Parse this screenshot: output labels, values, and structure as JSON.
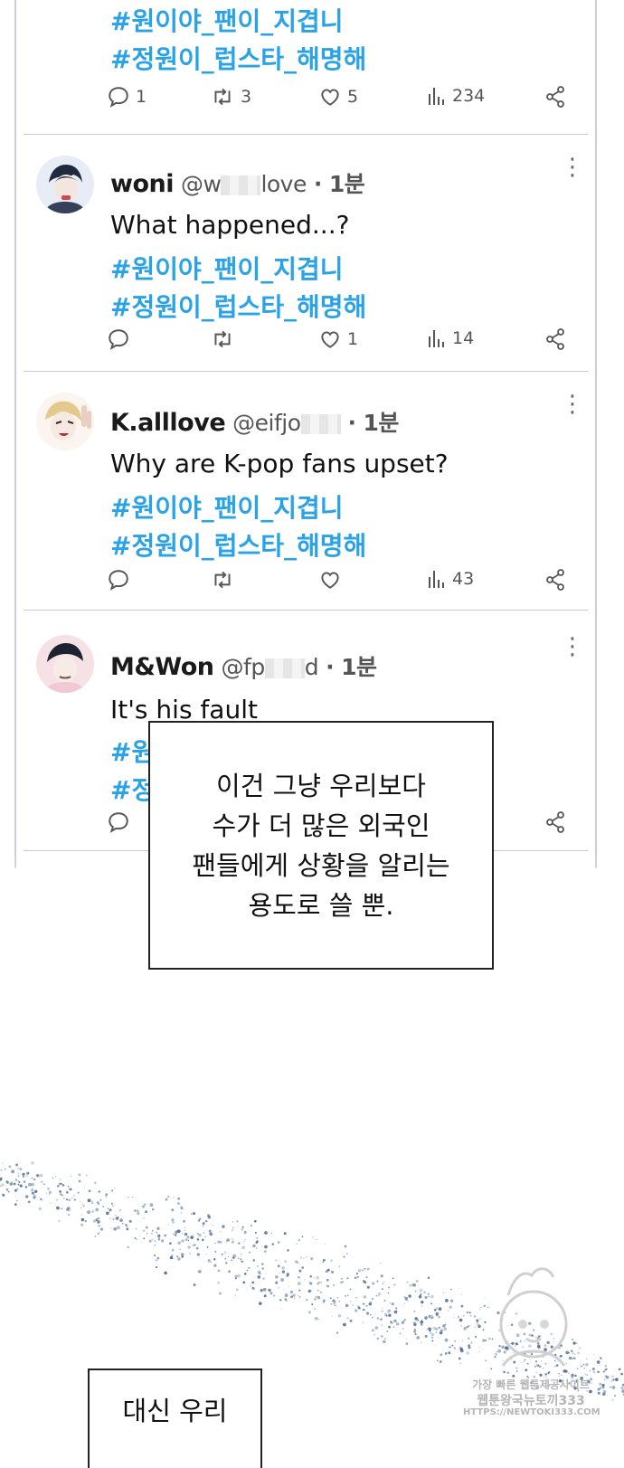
{
  "tweets": [
    {
      "tags": [
        "#원이야_팬이_지겹니",
        "#정원이_럽스타_해명해"
      ],
      "replies": "1",
      "retweets": "3",
      "likes": "5",
      "views": "234"
    },
    {
      "name": "woni",
      "handle_start": "@w",
      "handle_end": "love",
      "time": "1분",
      "text": "What happened...?",
      "tags": [
        "#원이야_팬이_지겹니",
        "#정원이_럽스타_해명해"
      ],
      "replies": "",
      "retweets": "",
      "likes": "1",
      "views": "14"
    },
    {
      "name": "K.alllove",
      "handle_start": "@eifjo",
      "handle_end": "",
      "time": "1분",
      "text": "Why are K-pop fans upset?",
      "tags": [
        "#원이야_팬이_지겹니",
        "#정원이_럽스타_해명해"
      ],
      "replies": "",
      "retweets": "",
      "likes": "",
      "views": "43"
    },
    {
      "name": "M&Won",
      "handle_start": "@fp",
      "handle_end": "d",
      "time": "1분",
      "text": "It's his fault",
      "tags": [
        "#원",
        "#정"
      ]
    }
  ],
  "separator": "·",
  "more_glyph": "⋮",
  "caption": {
    "lines": [
      "이건 그냥 우리보다",
      "수가 더 많은 외국인",
      "팬들에게 상황을 알리는",
      "용도로 쓸 뿐."
    ]
  },
  "caption2": {
    "text": "대신 우리"
  },
  "watermark": {
    "line1": "가장 빠른 웹툰제공사이트",
    "line2": "웹툰왕국뉴토끼333",
    "line3": "HTTPS://NEWTOKI333.COM"
  },
  "colors": {
    "hashtag": "#29a3e6",
    "border": "#c9cdd2",
    "sparkle": "#3d5f8a"
  },
  "icons": [
    "reply-icon",
    "retweet-icon",
    "like-icon",
    "views-icon",
    "share-icon",
    "more-icon"
  ]
}
